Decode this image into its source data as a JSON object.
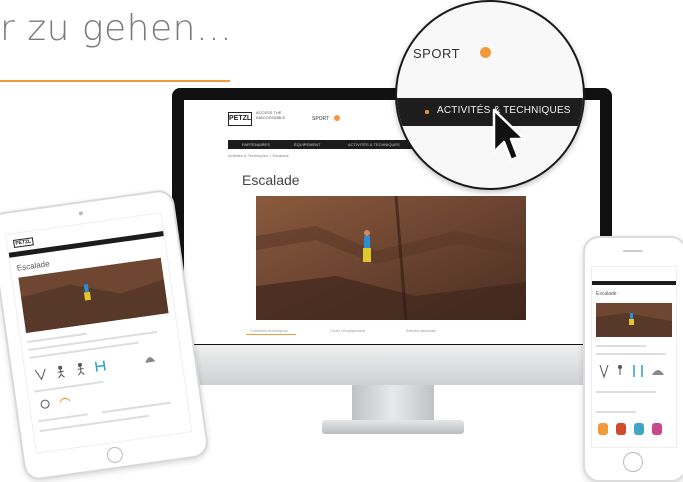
{
  "headline": {
    "text": "r zu gehen…"
  },
  "desktop_site": {
    "logo": "PETZL",
    "logo_tagline": "ACCESS THE INACCESSIBLE",
    "sport_label": "SPORT",
    "nav_items": [
      "PARTENAIRES",
      "ÉQUIPEMENT",
      "ACTIVITÉS & TECHNIQUES",
      "COMMUNAUTÉ"
    ],
    "breadcrumb": "Activités & Techniques   >   Escalade",
    "page_title": "Escalade",
    "tabs": [
      "Contenus techniques",
      "Choix d'équipement",
      "Articles associés"
    ]
  },
  "magnifier": {
    "sport_label": "SPORT",
    "nav_item_label": "ACTIVITÉS & TECHNIQUES"
  },
  "tablet_site": {
    "logo": "PETZL",
    "page_title": "Escalade"
  },
  "phone_site": {
    "page_title": "Escalade"
  },
  "colors": {
    "accent": "#f29a3a",
    "nav_bg": "#1c1c1c",
    "imac_bezel": "#111111"
  },
  "icons": [
    "mouse-cursor-icon"
  ]
}
